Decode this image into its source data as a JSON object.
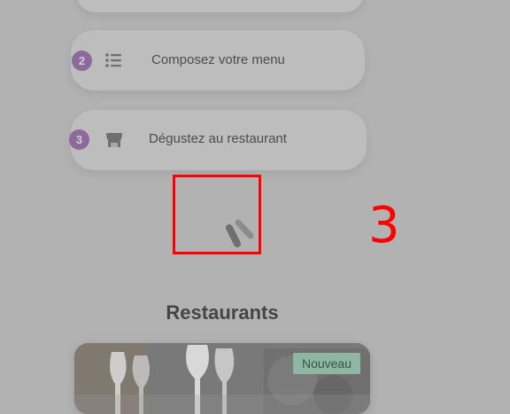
{
  "steps": [
    {
      "number": "2",
      "label": "Composez votre menu",
      "icon": "list-icon"
    },
    {
      "number": "3",
      "label": "Dégustez au restaurant",
      "icon": "storefront-icon"
    }
  ],
  "annotation": {
    "number": "3",
    "color": "#ff0000"
  },
  "loading": {
    "icon": "loading-spinner-icon"
  },
  "restaurants": {
    "title": "Restaurants",
    "cards": [
      {
        "badge": "Nouveau",
        "image": "restaurant-photo"
      }
    ]
  },
  "colors": {
    "overlay_background": "#b2b2b2",
    "badge_purple": "#8d6a9a",
    "new_badge_green": "#8fb6a2"
  }
}
